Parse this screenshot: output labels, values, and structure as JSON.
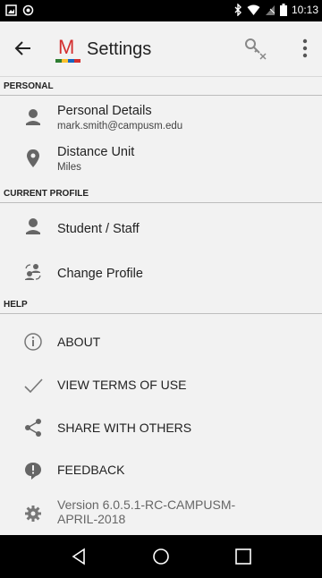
{
  "status_bar": {
    "time": "10:13",
    "icons": [
      "image-icon",
      "record-icon",
      "bluetooth-icon",
      "wifi-icon",
      "no-sim-icon",
      "battery-icon"
    ]
  },
  "app_bar": {
    "logo": "M",
    "title": "Settings",
    "icons": [
      "back-arrow-icon",
      "key-clear-icon",
      "overflow-menu-icon"
    ],
    "brand_color": "#d32f2f"
  },
  "sections": {
    "personal": "PERSONAL",
    "current_profile": "CURRENT PROFILE",
    "help": "HELP"
  },
  "items": {
    "personal_details": {
      "label": "Personal Details",
      "sub": "mark.smith@campusm.edu",
      "icon": "person-icon"
    },
    "distance_unit": {
      "label": "Distance Unit",
      "sub": "Miles",
      "icon": "location-pin-icon"
    },
    "student_staff": {
      "label": "Student / Staff",
      "icon": "person-icon"
    },
    "change_profile": {
      "label": "Change Profile",
      "icon": "switch-profile-icon"
    },
    "about": {
      "label": "ABOUT",
      "icon": "info-icon"
    },
    "terms": {
      "label": "VIEW TERMS OF USE",
      "icon": "check-icon"
    },
    "share": {
      "label": "SHARE WITH OTHERS",
      "icon": "share-icon"
    },
    "feedback": {
      "label": "FEEDBACK",
      "icon": "feedback-icon"
    },
    "version": {
      "label": "Version 6.0.5.1-RC-CAMPUSM-APRIL-2018",
      "icon": "settings-gear-icon"
    }
  },
  "nav": {
    "icons": [
      "nav-back-icon",
      "nav-home-icon",
      "nav-recents-icon"
    ]
  }
}
